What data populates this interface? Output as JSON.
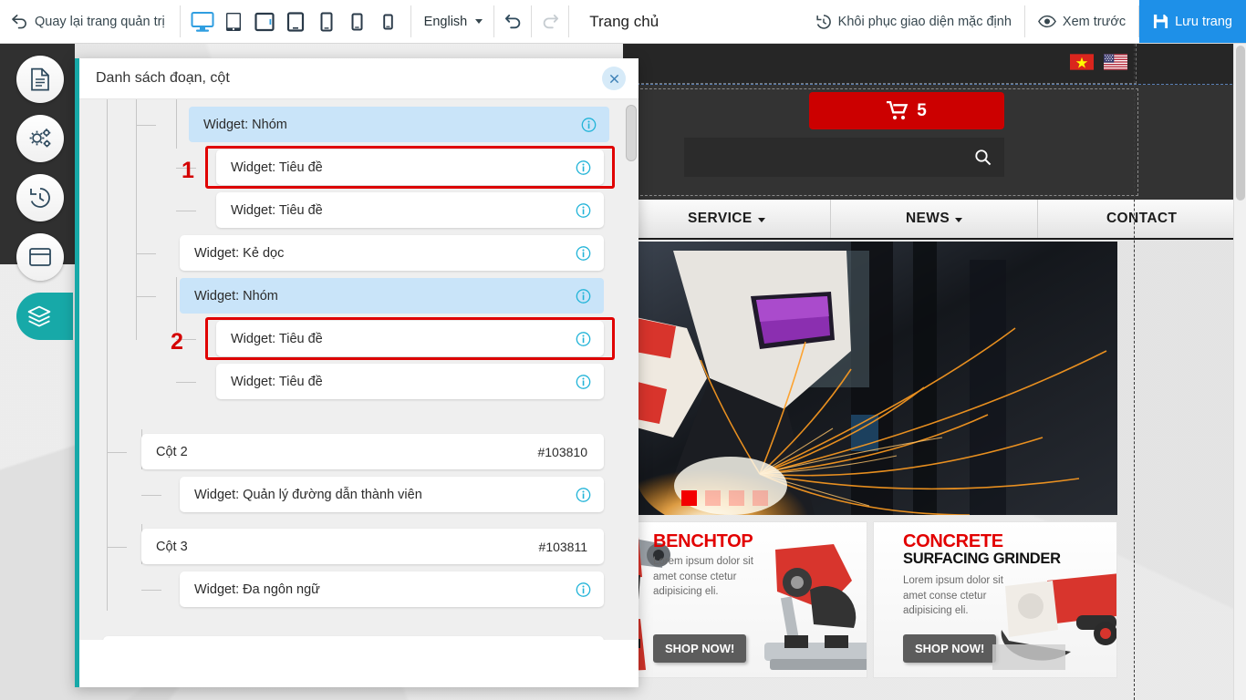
{
  "toolbar": {
    "back_label": "Quay lại trang quản trị",
    "back_icon": "undo-arrow-icon",
    "devices": [
      {
        "name": "desktop",
        "active": true
      },
      {
        "name": "tablet-landscape",
        "active": false
      },
      {
        "name": "tablet",
        "active": false
      },
      {
        "name": "tablet-portrait",
        "active": false
      },
      {
        "name": "phone-large",
        "active": false
      },
      {
        "name": "phone",
        "active": false
      },
      {
        "name": "phone-small",
        "active": false
      }
    ],
    "language": "English",
    "undo_icon": "undo-icon",
    "redo_icon": "redo-icon",
    "page_title": "Trang chủ",
    "restore_label": "Khôi phục giao diện mặc định",
    "restore_icon": "history-restore-icon",
    "preview_label": "Xem trước",
    "preview_icon": "eye-icon",
    "save_label": "Lưu trang",
    "save_icon": "floppy-disk-icon",
    "save_bg": "#1e90e8"
  },
  "sidebar": {
    "items": [
      {
        "name": "pages",
        "icon": "document-icon",
        "active": false
      },
      {
        "name": "settings",
        "icon": "gears-icon",
        "active": false
      },
      {
        "name": "history",
        "icon": "clock-rewind-icon",
        "active": false
      },
      {
        "name": "layout",
        "icon": "window-icon",
        "active": false
      },
      {
        "name": "layers",
        "icon": "layers-icon",
        "active": true
      }
    ],
    "active_color": "#17a9a8"
  },
  "modal": {
    "title": "Danh sách đoạn, cột",
    "close_icon": "close-icon",
    "accent_color": "#17a9a8",
    "selected_bg": "#c9e4f9",
    "highlight_color": "#e00000",
    "markers": [
      "1",
      "2"
    ],
    "rows": [
      {
        "label": "Widget: Nhóm",
        "depth": 2,
        "selected": true,
        "info": "info-icon",
        "id": null,
        "highlight": false,
        "marker": null
      },
      {
        "label": "Widget: Tiêu đề",
        "depth": 3,
        "selected": false,
        "info": "info-icon",
        "id": null,
        "highlight": true,
        "marker": "1"
      },
      {
        "label": "Widget: Tiêu đề",
        "depth": 3,
        "selected": false,
        "info": "info-icon",
        "id": null,
        "highlight": false,
        "marker": null
      },
      {
        "label": "Widget: Kẻ dọc",
        "depth": 2,
        "selected": false,
        "info": "info-icon",
        "id": null,
        "highlight": false,
        "marker": null
      },
      {
        "label": "Widget: Nhóm",
        "depth": 2,
        "selected": true,
        "info": "info-icon",
        "id": null,
        "highlight": false,
        "marker": null
      },
      {
        "label": "Widget: Tiêu đề",
        "depth": 3,
        "selected": false,
        "info": "info-icon",
        "id": null,
        "highlight": true,
        "marker": "2"
      },
      {
        "label": "Widget: Tiêu đề",
        "depth": 3,
        "selected": false,
        "info": "info-icon",
        "id": null,
        "highlight": false,
        "marker": null
      },
      {
        "label": "Cột 2",
        "depth": 1,
        "selected": false,
        "info": null,
        "id": "#103810",
        "highlight": false,
        "marker": null
      },
      {
        "label": "Widget: Quản lý đường dẫn thành viên",
        "depth": 2,
        "selected": false,
        "info": "info-icon",
        "id": null,
        "highlight": false,
        "marker": null
      },
      {
        "label": "Cột 3",
        "depth": 1,
        "selected": false,
        "info": null,
        "id": "#103811",
        "highlight": false,
        "marker": null
      },
      {
        "label": "Widget: Đa ngôn ngữ",
        "depth": 2,
        "selected": false,
        "info": "info-icon",
        "id": null,
        "highlight": false,
        "marker": null
      }
    ]
  },
  "preview": {
    "flags": [
      "vietnam-flag",
      "usa-flag"
    ],
    "cart": {
      "icon": "shopping-cart-icon",
      "count": "5",
      "bg": "#cc0000"
    },
    "search": {
      "icon": "search-icon",
      "value": "",
      "placeholder": ""
    },
    "nav": [
      {
        "label": "SERVICE",
        "caret": true
      },
      {
        "label": "NEWS",
        "caret": true
      },
      {
        "label": "CONTACT",
        "caret": false
      }
    ],
    "hero": {
      "alt": "welder-grinding-sparks-photo",
      "dots": 4,
      "active_dot": 1
    },
    "promos": [
      {
        "title1": "BENCHTOP",
        "title2": "",
        "body": "Lorem ipsum dolor sit amet conse ctetur adipisicing eli.",
        "cta": "SHOP NOW!",
        "image": "red-chop-saw-photo"
      },
      {
        "title1": "CONCRETE",
        "title2": "SURFACING GRINDER",
        "body": "Lorem ipsum dolor sit amet conse ctetur adipisicing eli.",
        "cta": "SHOP NOW!",
        "image": "red-angle-grinder-photo"
      }
    ],
    "scroll_top": {
      "icon": "chevron-up-icon",
      "bg": "#cc0000"
    }
  }
}
